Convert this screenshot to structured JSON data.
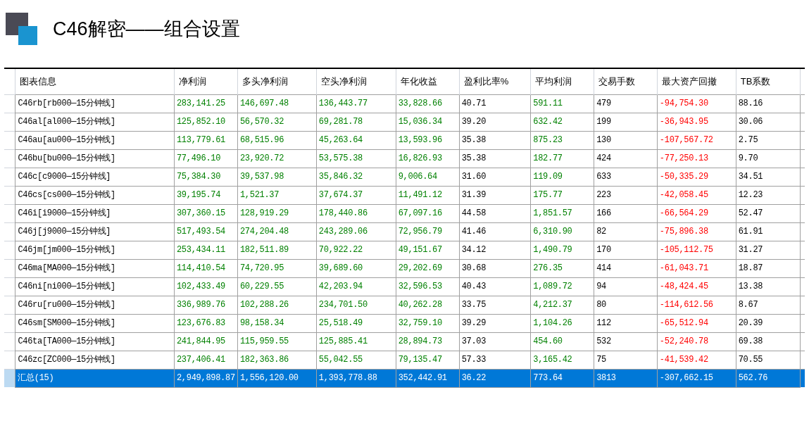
{
  "title": "C46解密——组合设置",
  "table": {
    "columns": [
      {
        "label": "图表信息",
        "color": "#000000"
      },
      {
        "label": "净利润",
        "color": "#008000"
      },
      {
        "label": "多头净利润",
        "color": "#008000"
      },
      {
        "label": "空头净利润",
        "color": "#008000"
      },
      {
        "label": "年化收益",
        "color": "#008000"
      },
      {
        "label": "盈利比率%",
        "color": "#000000"
      },
      {
        "label": "平均利润",
        "color": "#008000"
      },
      {
        "label": "交易手数",
        "color": "#000000"
      },
      {
        "label": "最大资产回撤",
        "color": "#ff0000"
      },
      {
        "label": "TB系数",
        "color": "#000000"
      }
    ],
    "rows": [
      {
        "selected": false,
        "cells": [
          "C46rb[rb000—15分钟线]",
          "283,141.25",
          "146,697.48",
          "136,443.77",
          "33,828.66",
          "40.71",
          "591.11",
          "479",
          "-94,754.30",
          "88.16"
        ]
      },
      {
        "selected": false,
        "cells": [
          "C46al[al000—15分钟线]",
          "125,852.10",
          "56,570.32",
          "69,281.78",
          "15,036.34",
          "39.20",
          "632.42",
          "199",
          "-36,943.95",
          "30.06"
        ]
      },
      {
        "selected": false,
        "cells": [
          "C46au[au000—15分钟线]",
          "113,779.61",
          "68,515.96",
          "45,263.64",
          "13,593.96",
          "35.38",
          "875.23",
          "130",
          "-107,567.72",
          "2.75"
        ]
      },
      {
        "selected": false,
        "cells": [
          "C46bu[bu000—15分钟线]",
          "77,496.10",
          "23,920.72",
          "53,575.38",
          "16,826.93",
          "35.38",
          "182.77",
          "424",
          "-77,250.13",
          "9.70"
        ]
      },
      {
        "selected": false,
        "cells": [
          "C46c[c9000—15分钟线]",
          "75,384.30",
          "39,537.98",
          "35,846.32",
          "9,006.64",
          "31.60",
          "119.09",
          "633",
          "-50,335.29",
          "34.51"
        ]
      },
      {
        "selected": false,
        "cells": [
          "C46cs[cs000—15分钟线]",
          "39,195.74",
          "1,521.37",
          "37,674.37",
          "11,491.12",
          "31.39",
          "175.77",
          "223",
          "-42,058.45",
          "12.23"
        ]
      },
      {
        "selected": false,
        "cells": [
          "C46i[i9000—15分钟线]",
          "307,360.15",
          "128,919.29",
          "178,440.86",
          "67,097.16",
          "44.58",
          "1,851.57",
          "166",
          "-66,564.29",
          "52.47"
        ]
      },
      {
        "selected": false,
        "cells": [
          "C46j[j9000—15分钟线]",
          "517,493.54",
          "274,204.48",
          "243,289.06",
          "72,956.79",
          "41.46",
          "6,310.90",
          "82",
          "-75,896.38",
          "61.91"
        ]
      },
      {
        "selected": false,
        "cells": [
          "C46jm[jm000—15分钟线]",
          "253,434.11",
          "182,511.89",
          "70,922.22",
          "49,151.67",
          "34.12",
          "1,490.79",
          "170",
          "-105,112.75",
          "31.27"
        ]
      },
      {
        "selected": false,
        "cells": [
          "C46ma[MA000—15分钟线]",
          "114,410.54",
          "74,720.95",
          "39,689.60",
          "29,202.69",
          "30.68",
          "276.35",
          "414",
          "-61,043.71",
          "18.87"
        ]
      },
      {
        "selected": false,
        "cells": [
          "C46ni[ni000—15分钟线]",
          "102,433.49",
          "60,229.55",
          "42,203.94",
          "32,596.53",
          "40.43",
          "1,089.72",
          "94",
          "-48,424.45",
          "13.38"
        ]
      },
      {
        "selected": false,
        "cells": [
          "C46ru[ru000—15分钟线]",
          "336,989.76",
          "102,288.26",
          "234,701.50",
          "40,262.28",
          "33.75",
          "4,212.37",
          "80",
          "-114,612.56",
          "8.67"
        ]
      },
      {
        "selected": false,
        "cells": [
          "C46sm[SM000—15分钟线]",
          "123,676.83",
          "98,158.34",
          "25,518.49",
          "32,759.10",
          "39.29",
          "1,104.26",
          "112",
          "-65,512.94",
          "20.39"
        ]
      },
      {
        "selected": false,
        "cells": [
          "C46ta[TA000—15分钟线]",
          "241,844.95",
          "115,959.55",
          "125,885.41",
          "28,894.73",
          "37.03",
          "454.60",
          "532",
          "-52,240.78",
          "69.38"
        ]
      },
      {
        "selected": false,
        "cells": [
          "C46zc[ZC000—15分钟线]",
          "237,406.41",
          "182,363.86",
          "55,042.55",
          "79,135.47",
          "57.33",
          "3,165.42",
          "75",
          "-41,539.42",
          "70.55"
        ]
      },
      {
        "selected": true,
        "cells": [
          "汇总(15)",
          "2,949,898.87",
          "1,556,120.00",
          "1,393,778.88",
          "352,442.91",
          "36.22",
          "773.64",
          "3813",
          "-307,662.15",
          "562.76"
        ]
      }
    ]
  }
}
